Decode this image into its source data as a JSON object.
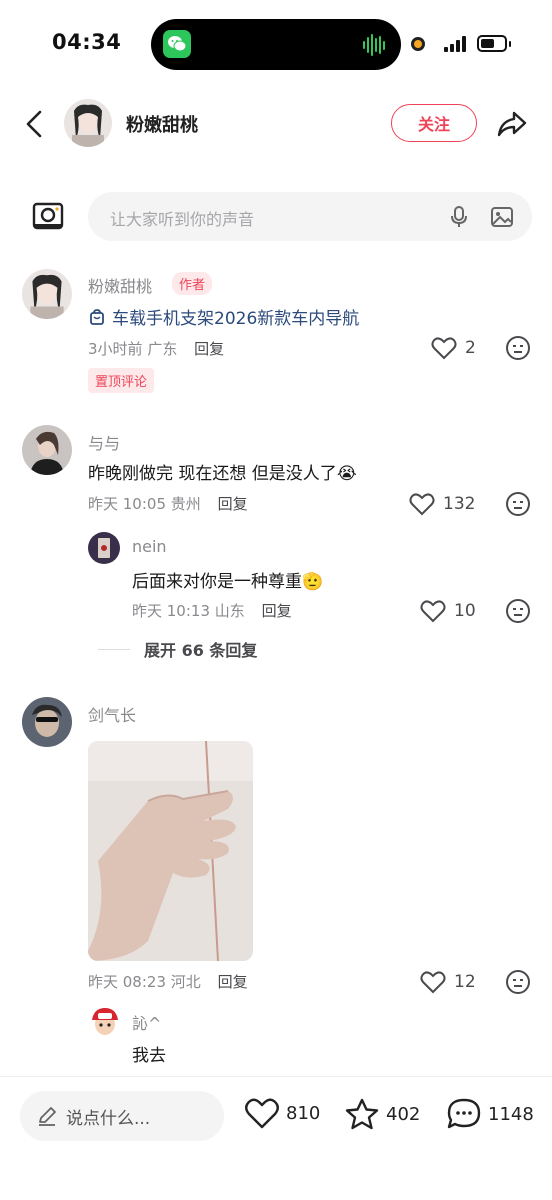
{
  "status_bar": {
    "time": "04:34"
  },
  "header": {
    "username": "粉嫩甜桃",
    "follow_label": "关注"
  },
  "comment_box": {
    "placeholder": "让大家听到你的声音"
  },
  "comments": [
    {
      "username": "粉嫩甜桃",
      "author_tag": "作者",
      "product_link": "车载手机支架2026新款车内导航",
      "time": "3小时前",
      "location": "广东",
      "reply_label": "回复",
      "likes": "2",
      "pin_tag": "置顶评论"
    },
    {
      "username": "与与",
      "text": "昨晚刚做完 现在还想 但是没人了",
      "emoji": "😭",
      "time": "昨天 10:05",
      "location": "贵州",
      "reply_label": "回复",
      "likes": "132",
      "reply": {
        "username": "nein",
        "text": "后面来对你是一种尊重",
        "emoji": "🫡",
        "time": "昨天 10:13",
        "location": "山东",
        "reply_label": "回复",
        "likes": "10"
      },
      "expand_label": "展开 66 条回复"
    },
    {
      "username": "剑气长",
      "time": "昨天 08:23",
      "location": "河北",
      "reply_label": "回复",
      "likes": "12",
      "reply": {
        "username": "訫^",
        "text": "我去"
      }
    }
  ],
  "bottom_bar": {
    "input_placeholder": "说点什么...",
    "likes": "810",
    "favorites": "402",
    "comments": "1148"
  },
  "colors": {
    "accent": "#ef4457",
    "link": "#2c4a7c",
    "muted_text": "#8a8a8e",
    "input_bg": "#f4f4f5"
  }
}
